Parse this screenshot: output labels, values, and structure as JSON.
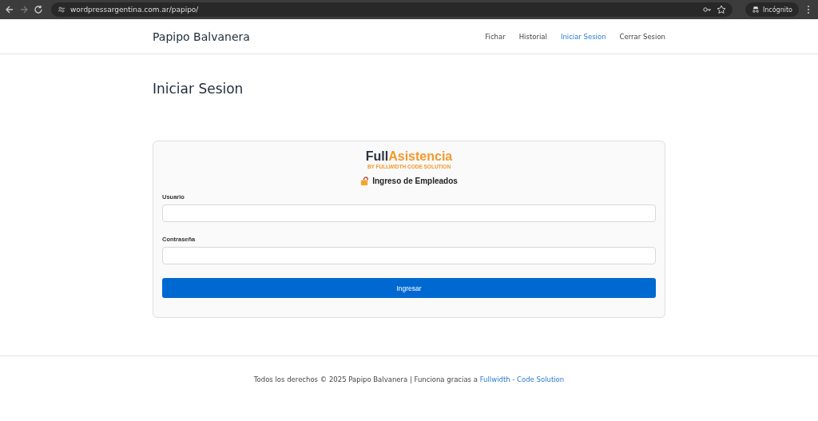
{
  "browser": {
    "url": "wordpressargentina.com.ar/papipo/",
    "profile": "Incógnito"
  },
  "header": {
    "site_title": "Papipo Balvanera",
    "nav": [
      {
        "label": "Fichar",
        "selected": false
      },
      {
        "label": "Historial",
        "selected": false
      },
      {
        "label": "Iniciar Sesion",
        "selected": true
      },
      {
        "label": "Cerrar Sesion",
        "selected": false
      }
    ]
  },
  "page_title": "Iniciar Sesion",
  "login_card": {
    "logo": {
      "dark_part": "Full",
      "accent_part": "Asistencia",
      "tagline": "BY FULLWIDTH CODE SOLUTION"
    },
    "heading": "Ingreso de Empleados",
    "fields": [
      {
        "label": "Usuario"
      },
      {
        "label": "Contraseña"
      }
    ],
    "submit": "Ingresar"
  },
  "footer": {
    "text": "Todos los derechos © 2025 Papipo Balvanera | Funciona gracias a",
    "link": "Fullwidth - Code Solution"
  }
}
